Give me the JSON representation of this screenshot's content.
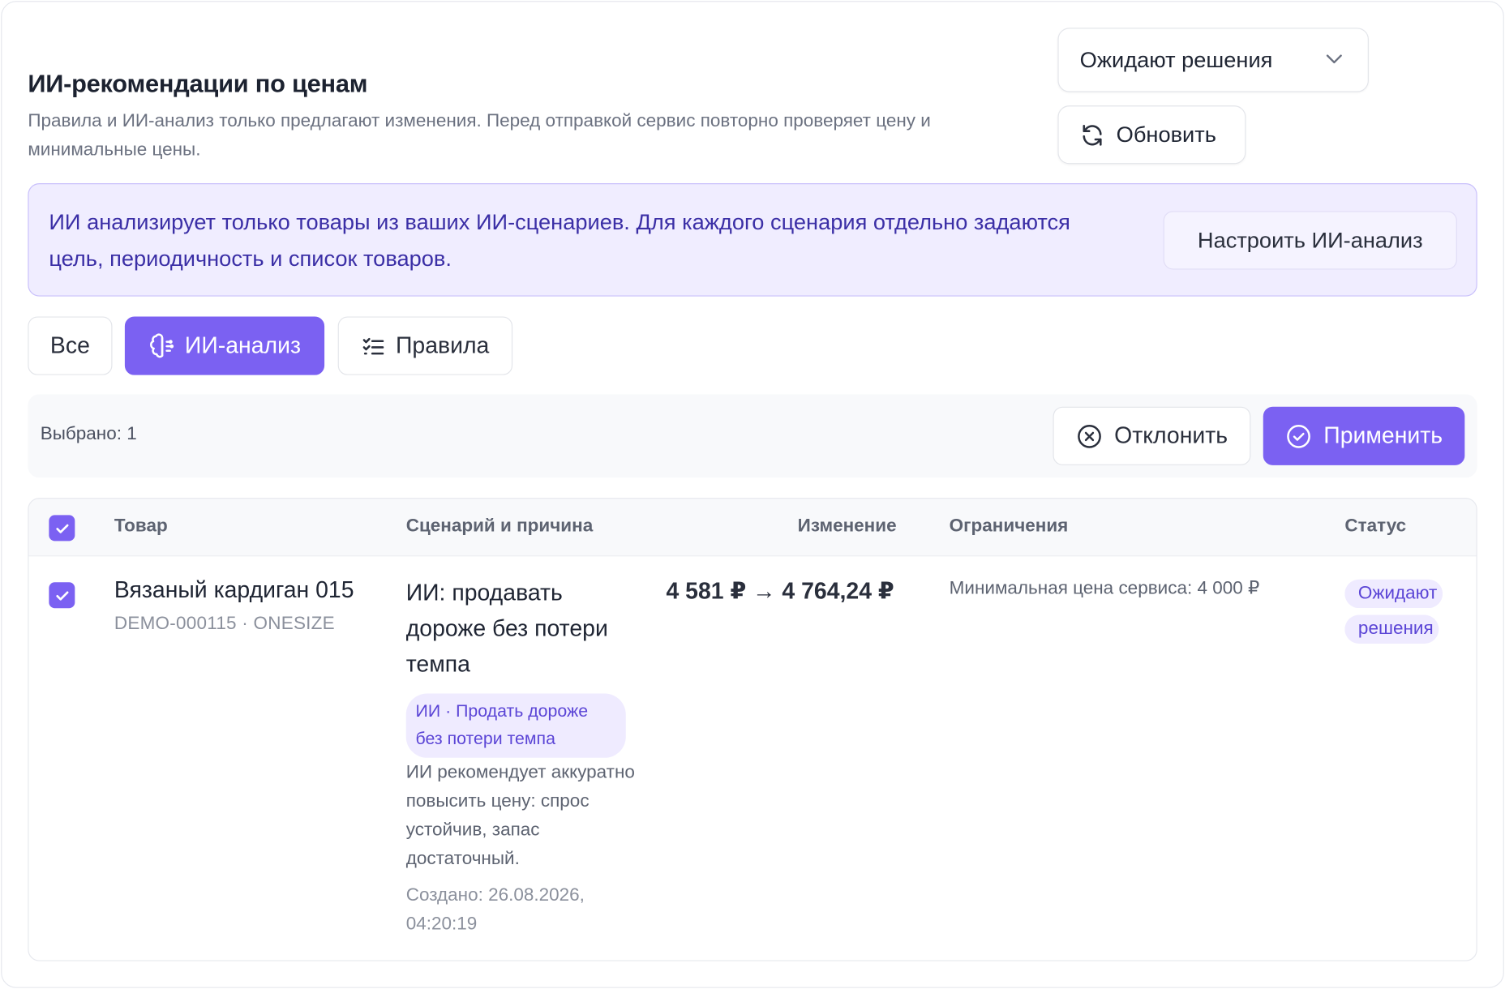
{
  "header": {
    "title": "ИИ-рекомендации по ценам",
    "subtitle": "Правила и ИИ-анализ только предлагают изменения. Перед отправкой сервис повторно проверяет цену и минимальные цены."
  },
  "status_filter": {
    "selected": "Ожидают решения"
  },
  "refresh_label": "Обновить",
  "notice": {
    "text": "ИИ анализирует только товары из ваших ИИ-сценариев. Для каждого сценария отдельно задаются цель, периодичность и список товаров.",
    "setup_label": "Настроить ИИ-анализ"
  },
  "tabs": [
    {
      "label": "Все",
      "active": false
    },
    {
      "label": "ИИ-анализ",
      "active": true,
      "icon": "brain-icon"
    },
    {
      "label": "Правила",
      "active": false,
      "icon": "checklist-icon"
    }
  ],
  "actionbar": {
    "selected_text": "Выбрано: 1",
    "reject_label": "Отклонить",
    "apply_label": "Применить"
  },
  "table": {
    "columns": [
      "Товар",
      "Сценарий и причина",
      "Изменение",
      "Ограничения",
      "Статус"
    ],
    "all_selected": true,
    "rows": [
      {
        "selected": true,
        "product_name": "Вязаный кардиган 015",
        "product_sku": "DEMO-000115 · ONESIZE",
        "scenario_title": "ИИ: продавать дороже без потери темпа",
        "scenario_tag": "ИИ · Продать дороже без потери темпа",
        "reason": "ИИ рекомендует аккуратно повысить цену: спрос устойчив, запас достаточный.",
        "created": "Создано: 26.08.2026, 04:20:19",
        "change": "4 581 ₽ → 4 764,24 ₽",
        "limits": "Минимальная цена сервиса: 4 000 ₽",
        "status": "Ожидают решения"
      }
    ]
  },
  "colors": {
    "accent": "#7b61f2",
    "notice_bg": "#f0edff",
    "notice_text": "#3b2fa6",
    "badge_bg": "#efebff",
    "badge_text": "#5b45d6"
  }
}
